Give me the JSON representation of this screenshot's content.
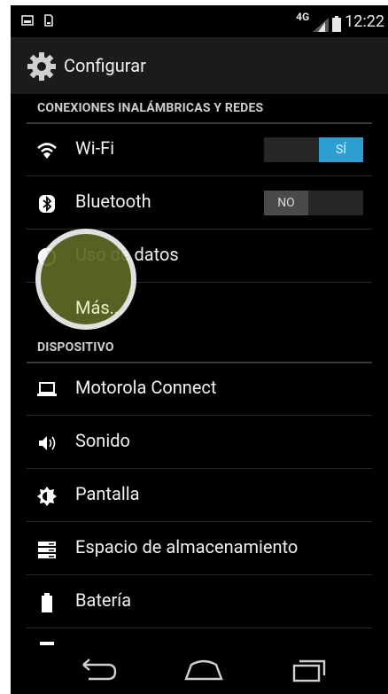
{
  "status_bar": {
    "network": "4G",
    "time": "12:22",
    "icons": [
      "image-notification-icon",
      "download-notification-icon",
      "signal-icon",
      "battery-icon"
    ]
  },
  "action_bar": {
    "title": "Configurar",
    "icon": "gear-icon"
  },
  "sections": [
    {
      "id": "wireless",
      "label": "CONEXIONES INALÁMBRICAS Y REDES"
    },
    {
      "id": "device",
      "label": "DISPOSITIVO"
    }
  ],
  "wireless_items": [
    {
      "label": "Wi-Fi",
      "icon": "wifi-icon",
      "switch": {
        "state": "on",
        "text": "SÍ"
      }
    },
    {
      "label": "Bluetooth",
      "icon": "bluetooth-icon",
      "switch": {
        "state": "off",
        "text": "NO"
      }
    },
    {
      "label": "Uso de datos",
      "icon": "data-usage-icon"
    },
    {
      "label": "Más...",
      "icon": null
    }
  ],
  "device_items": [
    {
      "label": "Motorola Connect",
      "icon": "laptop-icon"
    },
    {
      "label": "Sonido",
      "icon": "speaker-icon"
    },
    {
      "label": "Pantalla",
      "icon": "brightness-icon"
    },
    {
      "label": "Espacio de almacenamiento",
      "icon": "storage-icon"
    },
    {
      "label": "Batería",
      "icon": "battery-icon"
    }
  ],
  "nav_bar": {
    "buttons": [
      "back-icon",
      "home-icon",
      "recents-icon"
    ]
  },
  "colors": {
    "accent": "#2d9ed0",
    "background": "#000000",
    "action_bar": "#1b1b1b",
    "touch_highlight": "#5e6a26"
  }
}
